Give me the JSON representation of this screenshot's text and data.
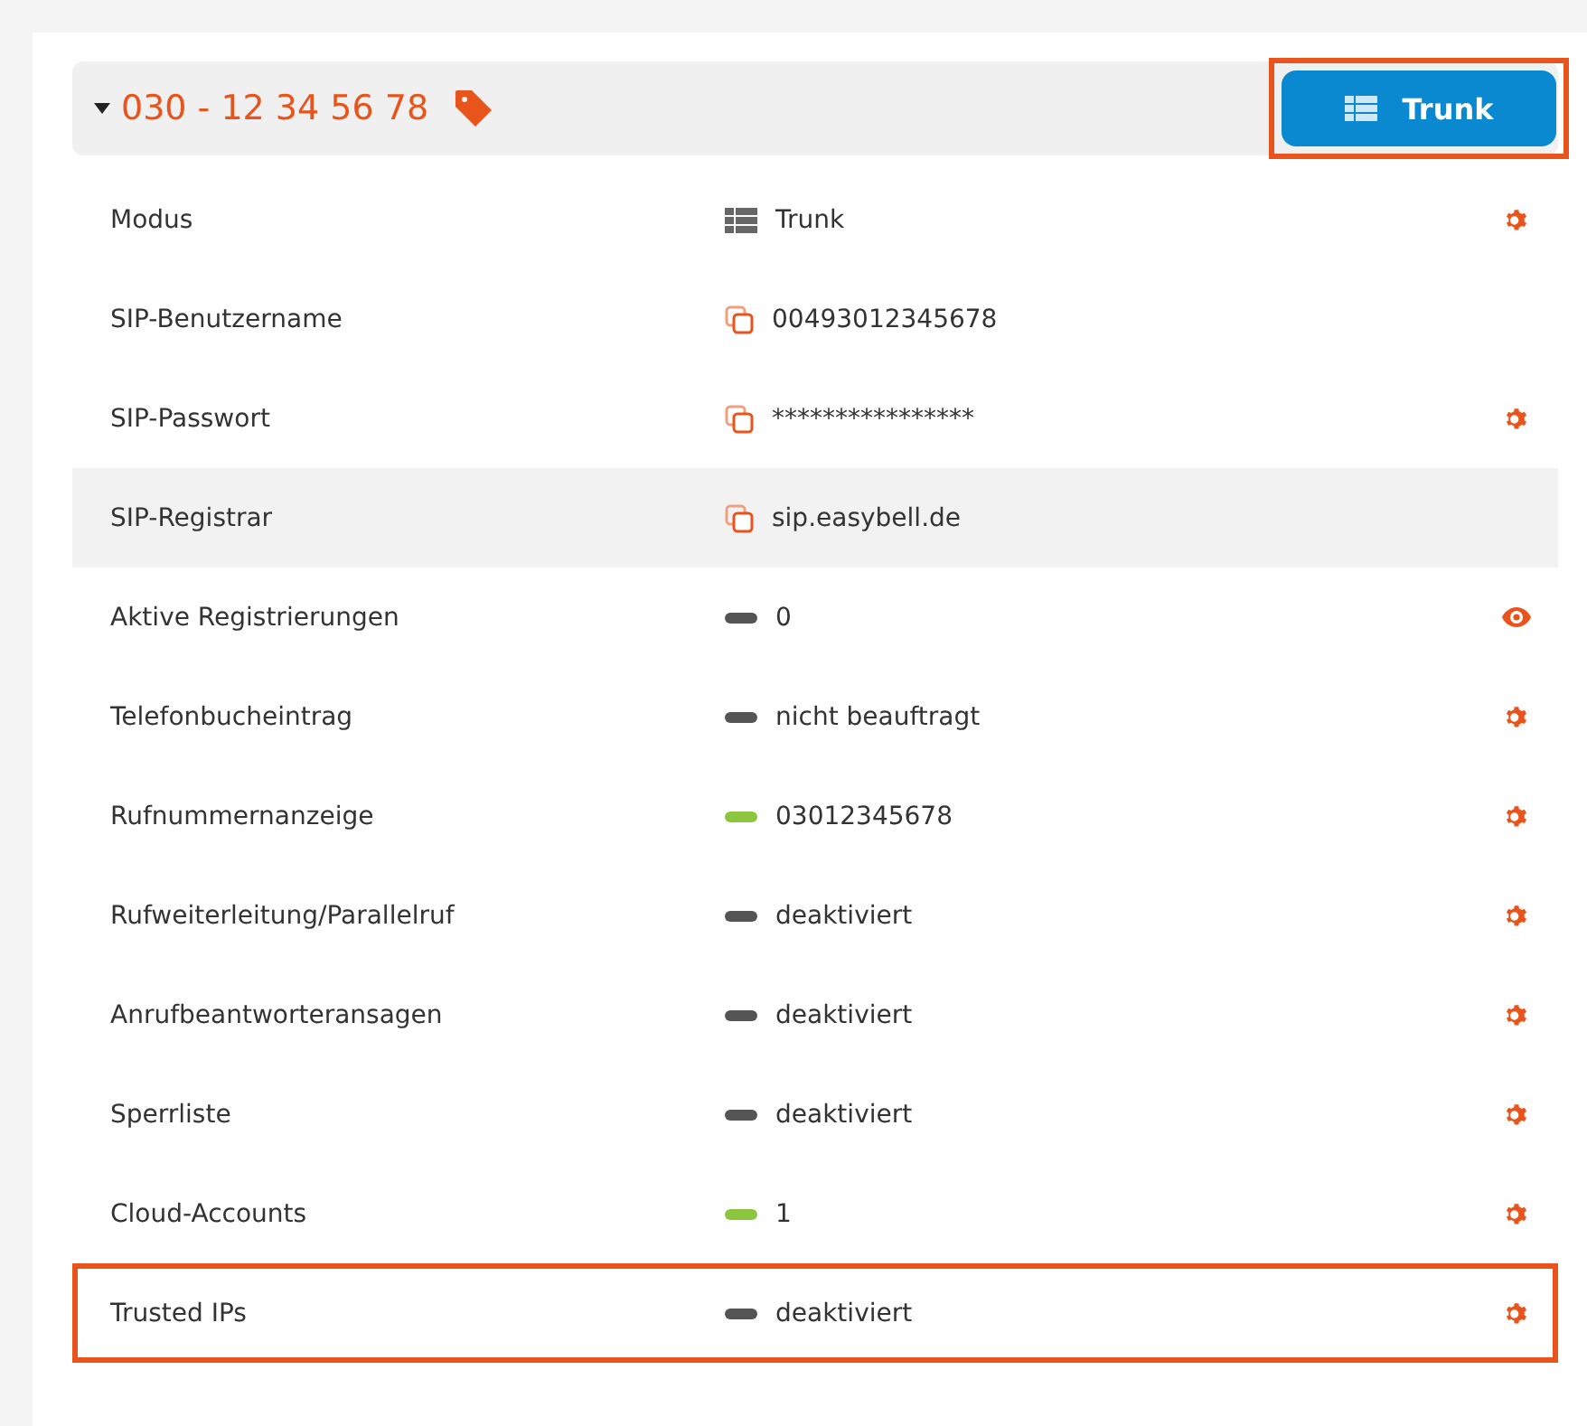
{
  "header": {
    "expanded": true,
    "number": "030 - 12 34 56 78",
    "button": {
      "label": "Trunk",
      "outlined": true
    }
  },
  "rows": [
    {
      "label": "Modus",
      "kind": "trunk",
      "value": "Trunk",
      "action": {
        "kind": "gear"
      },
      "hovered": false,
      "outlined": false
    },
    {
      "label": "SIP-Benutzername",
      "kind": "copy",
      "value": "00493012345678",
      "hovered": false,
      "outlined": false
    },
    {
      "label": "SIP-Passwort",
      "kind": "copy",
      "value": "****************",
      "action": {
        "kind": "gear"
      },
      "hovered": false,
      "outlined": false
    },
    {
      "label": "SIP-Registrar",
      "kind": "copy",
      "value": "sip.easybell.de",
      "hovered": true,
      "outlined": false
    },
    {
      "label": "Aktive Registrierungen",
      "kind": "status",
      "color": "#555555",
      "value": "0",
      "action": {
        "kind": "eye"
      },
      "hovered": false,
      "outlined": false
    },
    {
      "label": "Telefonbucheintrag",
      "kind": "status",
      "color": "#555555",
      "value": "nicht beauftragt",
      "action": {
        "kind": "gear"
      },
      "hovered": false,
      "outlined": false
    },
    {
      "label": "Rufnummernanzeige",
      "kind": "status",
      "color": "#8cc63f",
      "value": "03012345678",
      "action": {
        "kind": "gear"
      },
      "hovered": false,
      "outlined": false
    },
    {
      "label": "Rufweiterleitung/Parallelruf",
      "kind": "status",
      "color": "#555555",
      "value": "deaktiviert",
      "action": {
        "kind": "gear"
      },
      "hovered": false,
      "outlined": false
    },
    {
      "label": "Anrufbeantworteransagen",
      "kind": "status",
      "color": "#555555",
      "value": "deaktiviert",
      "action": {
        "kind": "gear"
      },
      "hovered": false,
      "outlined": false
    },
    {
      "label": "Sperrliste",
      "kind": "status",
      "color": "#555555",
      "value": "deaktiviert",
      "action": {
        "kind": "gear"
      },
      "hovered": false,
      "outlined": false
    },
    {
      "label": "Cloud-Accounts",
      "kind": "status",
      "color": "#8cc63f",
      "value": "1",
      "action": {
        "kind": "gear"
      },
      "hovered": false,
      "outlined": false
    },
    {
      "label": "Trusted IPs",
      "kind": "status",
      "color": "#555555",
      "value": "deaktiviert",
      "action": {
        "kind": "gear"
      },
      "hovered": false,
      "outlined": true
    }
  ]
}
